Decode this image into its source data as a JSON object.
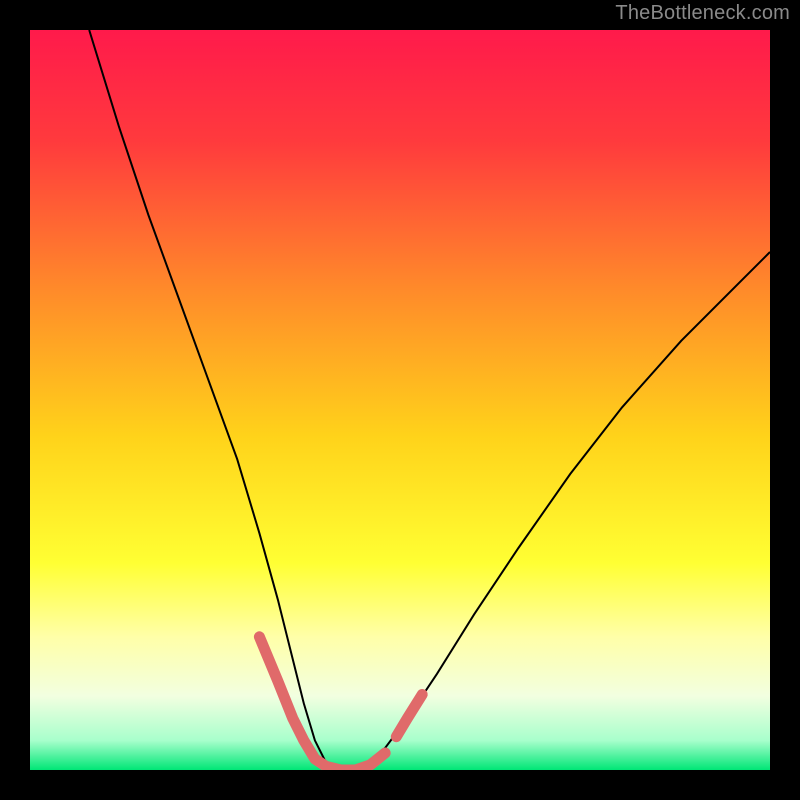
{
  "watermark": "TheBottleneck.com",
  "chart_data": {
    "type": "line",
    "title": "",
    "xlabel": "",
    "ylabel": "",
    "xlim": [
      0,
      100
    ],
    "ylim": [
      0,
      100
    ],
    "grid": false,
    "legend": false,
    "gradient_stops": [
      {
        "offset": 0,
        "color": "#ff1a4b"
      },
      {
        "offset": 0.15,
        "color": "#ff3a3d"
      },
      {
        "offset": 0.35,
        "color": "#ff8a2a"
      },
      {
        "offset": 0.55,
        "color": "#ffd31a"
      },
      {
        "offset": 0.72,
        "color": "#ffff33"
      },
      {
        "offset": 0.82,
        "color": "#ffffa8"
      },
      {
        "offset": 0.9,
        "color": "#f2ffe0"
      },
      {
        "offset": 0.96,
        "color": "#a8ffcc"
      },
      {
        "offset": 1.0,
        "color": "#00e676"
      }
    ],
    "series": [
      {
        "name": "bottleneck-curve",
        "stroke": "#000000",
        "stroke_width": 2,
        "x": [
          8,
          12,
          16,
          20,
          24,
          28,
          31,
          33.5,
          35.5,
          37,
          38.5,
          40,
          42,
          44,
          46,
          48,
          51,
          55,
          60,
          66,
          73,
          80,
          88,
          96,
          100
        ],
        "y": [
          100,
          87,
          75,
          64,
          53,
          42,
          32,
          23,
          15,
          9,
          4,
          1,
          0,
          0,
          1,
          3,
          7,
          13,
          21,
          30,
          40,
          49,
          58,
          66,
          70
        ]
      },
      {
        "name": "highlight-segments",
        "stroke": "#e06a6a",
        "stroke_width": 11,
        "linecap": "round",
        "segments": [
          {
            "x": [
              31,
              33.5,
              35.5,
              37,
              38.5,
              40,
              42,
              44,
              46,
              48
            ],
            "y": [
              18,
              12,
              7,
              4,
              1.5,
              0.5,
              0,
              0,
              0.7,
              2.3
            ]
          },
          {
            "x": [
              49.5,
              51,
              53
            ],
            "y": [
              4.5,
              7,
              10.2
            ]
          }
        ]
      }
    ]
  }
}
